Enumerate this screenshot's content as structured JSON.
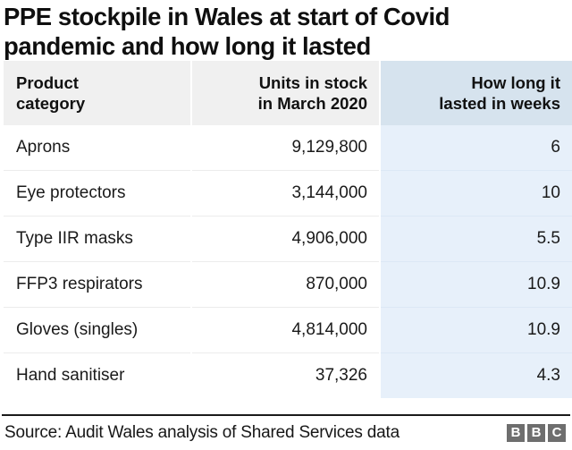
{
  "title": "PPE stockpile in Wales at start of Covid\npandemic and how long it lasted",
  "table": {
    "headers": {
      "category": "Product\ncategory",
      "units": "Units in stock\nin March 2020",
      "weeks": "How long it\nlasted in weeks"
    },
    "rows": [
      {
        "category": "Aprons",
        "units": "9,129,800",
        "weeks": "6"
      },
      {
        "category": "Eye protectors",
        "units": "3,144,000",
        "weeks": "10"
      },
      {
        "category": "Type IIR masks",
        "units": "4,906,000",
        "weeks": "5.5"
      },
      {
        "category": "FFP3 respirators",
        "units": "870,000",
        "weeks": "10.9"
      },
      {
        "category": "Gloves (singles)",
        "units": "4,814,000",
        "weeks": "10.9"
      },
      {
        "category": "Hand sanitiser",
        "units": "37,326",
        "weeks": "4.3"
      }
    ]
  },
  "footer": {
    "source": "Source: Audit Wales analysis of Shared Services data",
    "logo": [
      "B",
      "B",
      "C"
    ]
  },
  "colors": {
    "header_bg": "#f0f0f0",
    "header_highlight_bg": "#d6e3ee",
    "cell_highlight_bg": "#e7f0fa",
    "rule": "#1b1b1b",
    "logo_bg": "#6e6e6e"
  },
  "chart_data": {
    "type": "table",
    "title": "PPE stockpile in Wales at start of Covid pandemic and how long it lasted",
    "columns": [
      "Product category",
      "Units in stock in March 2020",
      "How long it lasted in weeks"
    ],
    "rows": [
      [
        "Aprons",
        9129800,
        6
      ],
      [
        "Eye protectors",
        3144000,
        10
      ],
      [
        "Type IIR masks",
        4906000,
        5.5
      ],
      [
        "FFP3 respirators",
        870000,
        10.9
      ],
      [
        "Gloves (singles)",
        4814000,
        10.9
      ],
      [
        "Hand sanitiser",
        37326,
        4.3
      ]
    ],
    "highlighted_column": "How long it lasted in weeks",
    "source": "Audit Wales analysis of Shared Services data"
  }
}
